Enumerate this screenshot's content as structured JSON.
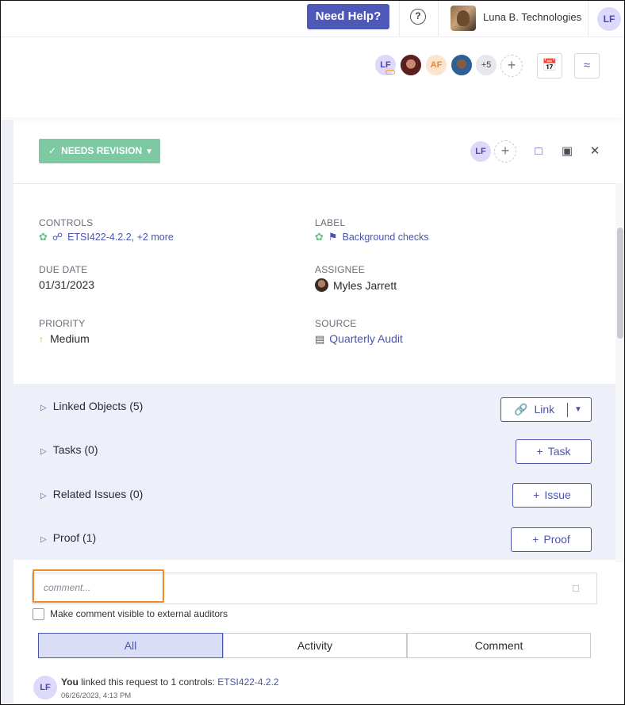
{
  "topbar": {
    "help_label": "Need Help?",
    "help_icon": "question-icon",
    "org_name": "Luna B. Technologies",
    "user_initials": "LF"
  },
  "people": {
    "avatars": [
      {
        "initials": "LF",
        "color": "#ddd9fb",
        "text": "#4d46a8"
      },
      {
        "initials": "",
        "color": "#7a2a2a"
      },
      {
        "initials": "AF",
        "color": "#fde4cf",
        "text": "#e08a3a"
      },
      {
        "initials": "",
        "color": "#3e6fa3"
      }
    ],
    "more_count": "+5",
    "add_icon": "plus-icon",
    "calendar_icon": "calendar-check-icon",
    "feed_icon": "rss-icon"
  },
  "panel": {
    "status_label": "NEEDS REVISION",
    "assignee_initials": "LF",
    "comment_icon": "comment-icon",
    "archive_icon": "archive-icon",
    "close_icon": "close-icon"
  },
  "fields": {
    "controls_label": "CONTROLS",
    "controls_value": "ETSI422-4.2.2, +2 more",
    "label_label": "LABEL",
    "label_value": "Background checks",
    "due_label": "DUE DATE",
    "due_value": "01/31/2023",
    "assignee_label": "ASSIGNEE",
    "assignee_value": "Myles Jarrett",
    "priority_label": "PRIORITY",
    "priority_value": "Medium",
    "source_label": "SOURCE",
    "source_value": "Quarterly Audit"
  },
  "linked": {
    "rows": [
      {
        "label": "Linked Objects (5)",
        "button": "Link"
      },
      {
        "label": "Tasks (0)",
        "button": "Task"
      },
      {
        "label": "Related Issues (0)",
        "button": "Issue"
      },
      {
        "label": "Proof (1)",
        "button": "Proof"
      }
    ]
  },
  "comment": {
    "placeholder": "comment...",
    "visible_label": "Make comment visible to external auditors"
  },
  "tabs": [
    "All",
    "Activity",
    "Comment"
  ],
  "activity": {
    "initials": "LF",
    "actor": "You",
    "text": " linked this request to 1 controls: ",
    "link": "ETSI422-4.2.2",
    "time": "06/26/2023, 4:13 PM"
  }
}
